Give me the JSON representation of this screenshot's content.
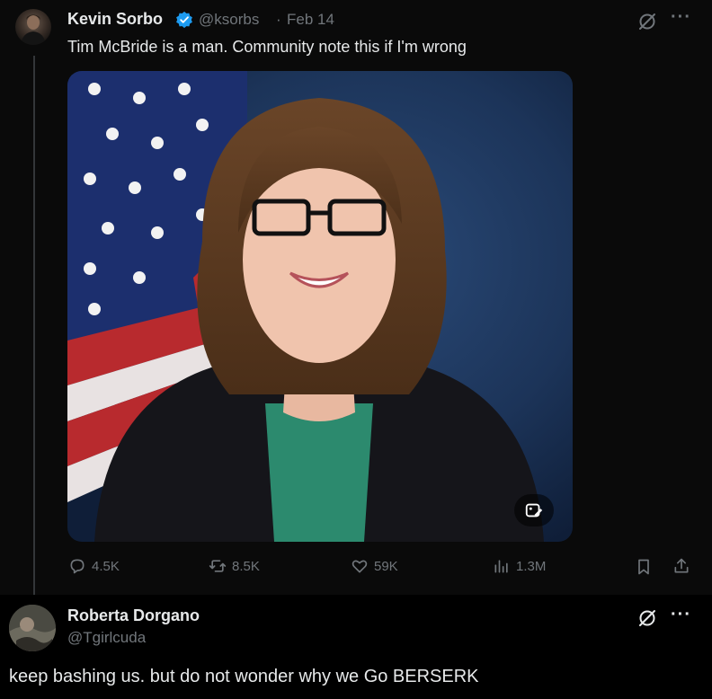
{
  "tweet": {
    "author_name": "Kevin Sorbo",
    "author_handle": "@ksorbs",
    "separator": "·",
    "date": "Feb 14",
    "text": "Tim McBride is a man. Community note this if I'm wrong",
    "actions": {
      "replies": "4.5K",
      "retweets": "8.5K",
      "likes": "59K",
      "views": "1.3M"
    },
    "more_label": "···"
  },
  "reply": {
    "author_name": "Roberta Dorgano",
    "author_handle": "@Tgirlcuda",
    "text": "keep bashing us. but do not wonder why we Go BERSERK",
    "more_label": "···"
  },
  "colors": {
    "background": "#0a0a0a",
    "text": "#e7e9ea",
    "muted": "#71767b",
    "verified": "#1d9bf0"
  },
  "icons": [
    "verified-badge-icon",
    "grok-icon",
    "more-icon",
    "image-edit-icon",
    "reply-icon",
    "retweet-icon",
    "like-icon",
    "views-icon",
    "bookmark-icon",
    "share-icon"
  ]
}
